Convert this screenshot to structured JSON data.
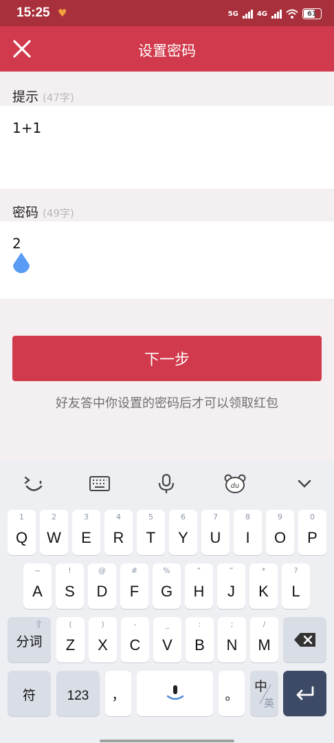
{
  "status_bar": {
    "time": "15:25",
    "net1": "5G",
    "net2": "4G",
    "battery": "61"
  },
  "header": {
    "title": "设置密码"
  },
  "hint_section": {
    "label": "提示",
    "count": "(47字)",
    "value": "1+1"
  },
  "password_section": {
    "label": "密码",
    "count": "(49字)",
    "value": "2"
  },
  "next_button": {
    "label": "下一步"
  },
  "footer_hint": "好友答中你设置的密码后才可以领取红包",
  "keyboard": {
    "row1": [
      {
        "main": "Q",
        "sub": "1"
      },
      {
        "main": "W",
        "sub": "2"
      },
      {
        "main": "E",
        "sub": "3"
      },
      {
        "main": "R",
        "sub": "4"
      },
      {
        "main": "T",
        "sub": "5"
      },
      {
        "main": "Y",
        "sub": "6"
      },
      {
        "main": "U",
        "sub": "7"
      },
      {
        "main": "I",
        "sub": "8"
      },
      {
        "main": "O",
        "sub": "9"
      },
      {
        "main": "P",
        "sub": "0"
      }
    ],
    "row2": [
      {
        "main": "A",
        "sub": "~"
      },
      {
        "main": "S",
        "sub": "!"
      },
      {
        "main": "D",
        "sub": "@"
      },
      {
        "main": "F",
        "sub": "#"
      },
      {
        "main": "G",
        "sub": "%"
      },
      {
        "main": "H",
        "sub": "“"
      },
      {
        "main": "J",
        "sub": "”"
      },
      {
        "main": "K",
        "sub": "*"
      },
      {
        "main": "L",
        "sub": "?"
      }
    ],
    "row3": [
      {
        "main": "Z",
        "sub": "("
      },
      {
        "main": "X",
        "sub": ")"
      },
      {
        "main": "C",
        "sub": "-"
      },
      {
        "main": "V",
        "sub": "_"
      },
      {
        "main": "B",
        "sub": ":"
      },
      {
        "main": "N",
        "sub": ";"
      },
      {
        "main": "M",
        "sub": "/"
      }
    ],
    "shift_label": "分词",
    "symbol_label": "符",
    "num_label": "123",
    "comma_label": "，",
    "period_label": "。",
    "lang_primary": "中",
    "lang_secondary": "英"
  }
}
